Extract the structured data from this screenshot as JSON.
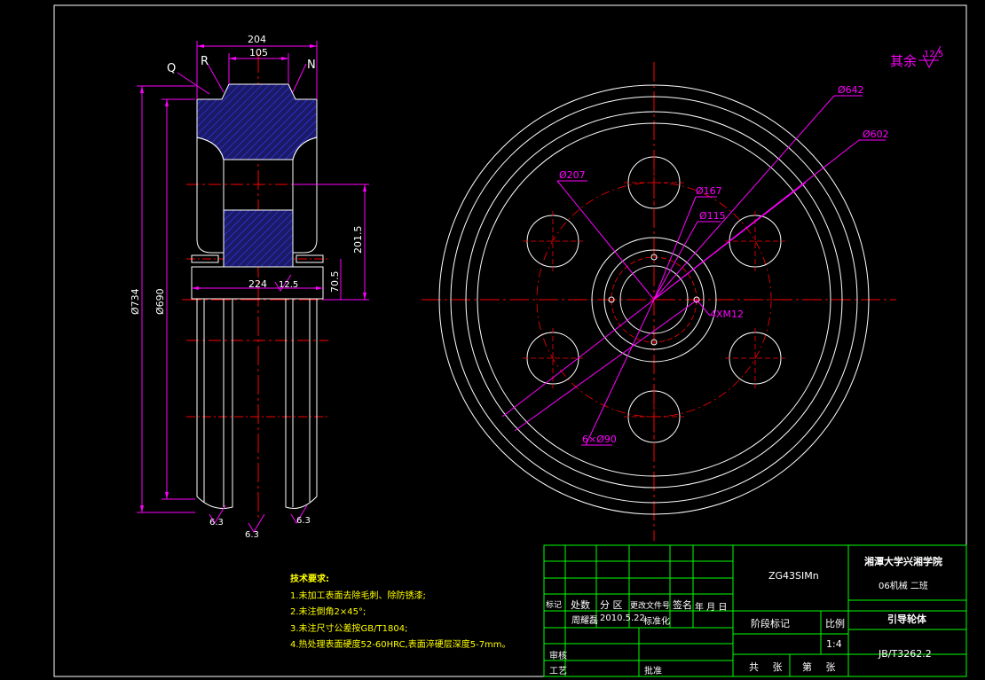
{
  "colors": {
    "background": "#000000",
    "outline": "#ffffff",
    "dimension": "#ff00ff",
    "centerline": "#ff0000",
    "hatch": "#0000ff",
    "hatch_fill": "#1a1a66",
    "notes": "#ffff00",
    "table_grid": "#00ff00",
    "border": "#ffffff"
  },
  "side_view": {
    "labels": {
      "q": "Q",
      "r": "R",
      "n": "N"
    },
    "dims": {
      "width_top": "204",
      "width_inner": "105",
      "overall_dia": "Ø734",
      "tread_dia": "Ø690",
      "half_height": "201.5",
      "hub_height": "70.5",
      "hub_width": "224",
      "roughness_mid": "12.5",
      "roughness_bottom_a": "6.3",
      "roughness_bottom_b": "6.3",
      "roughness_bottom_c": "6.3"
    }
  },
  "front_view": {
    "dims": {
      "d642": "Ø642",
      "d602": "Ø602",
      "d207": "Ø207",
      "d167": "Ø167",
      "d115": "Ø115",
      "thread": "4XM12",
      "holes": "6×Ø90"
    },
    "roughness_other_label": "其余",
    "roughness_other_value": "12.5"
  },
  "notes": {
    "title": "技术要求:",
    "items": [
      "1.未加工表面去除毛刺、除防锈漆;",
      "2.未注倒角2×45°;",
      "3.未注尺寸公差按GB/T1804;",
      "4.热处理表面硬度52-60HRC,表面淬硬层深度5-7mm。"
    ]
  },
  "title_block": {
    "material": "ZG43SIMn",
    "school": "湘潭大学兴湘学院",
    "class_name": "06机械 二班",
    "part_name": "引导轮体",
    "standard": "JB/T3262.2",
    "stage_mark": "阶段标记",
    "scale_label": "比例",
    "scale_value": "1:4",
    "total_sheets": "共 张",
    "sheet_no": "第 张",
    "header_cells": [
      "标记",
      "处数",
      "分 区",
      "更改文件号",
      "签名",
      "年 月 日"
    ],
    "designer": "周耀磊",
    "date": "2010.5.22",
    "standardize": "标准化",
    "review": "审核",
    "process": "工艺",
    "approve": "批准"
  }
}
